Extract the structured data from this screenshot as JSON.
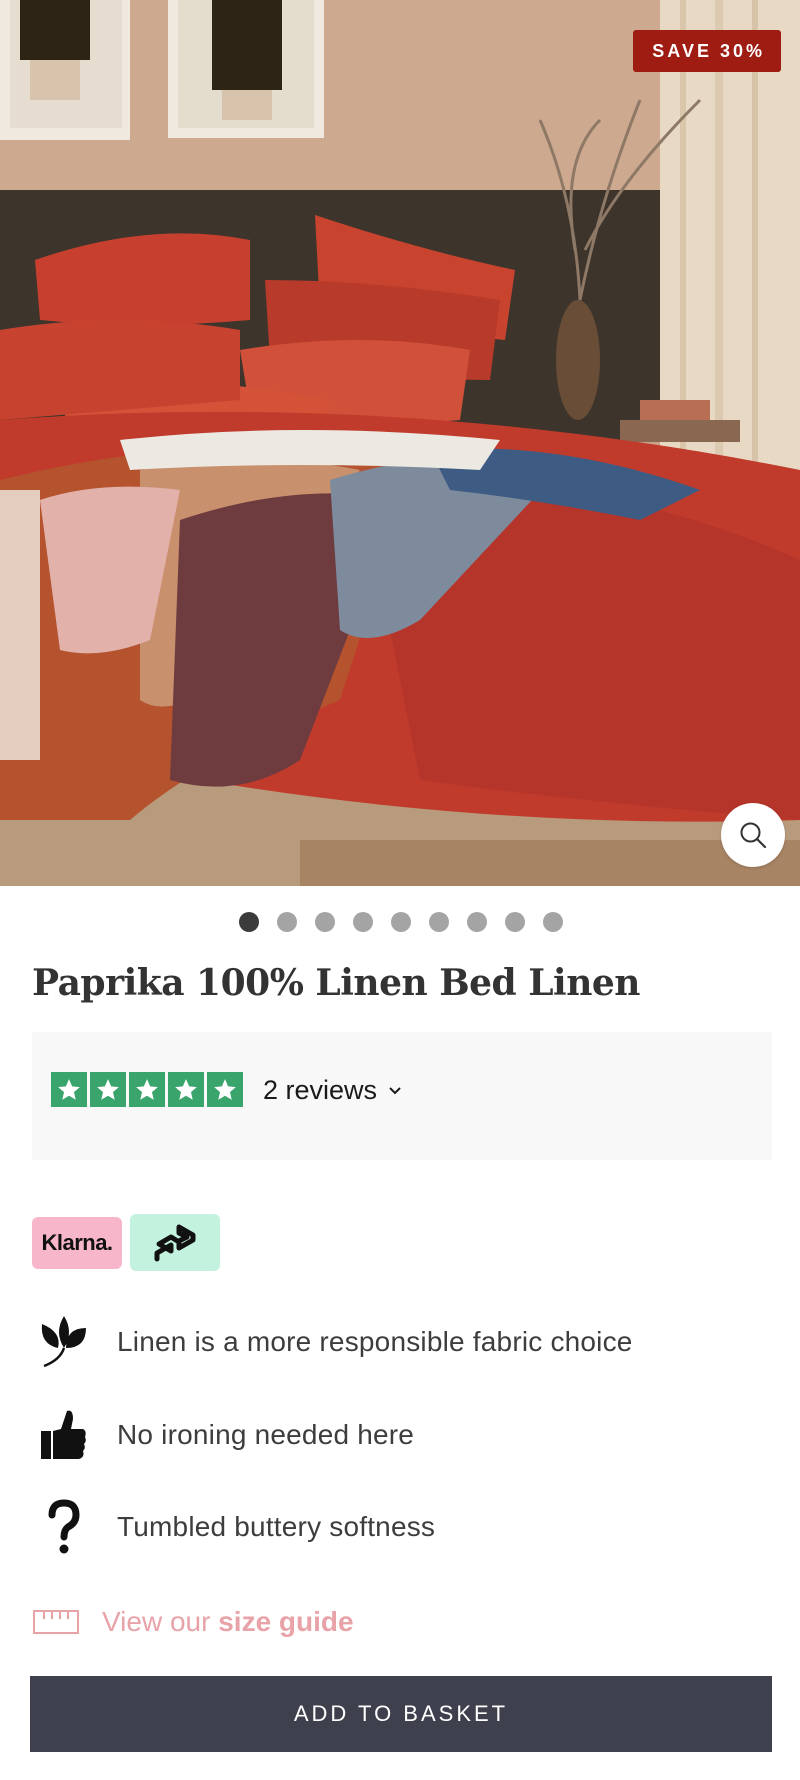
{
  "hero": {
    "badge": "SAVE 30%",
    "image_alt": "Paprika linen bedding on a bed with throws",
    "zoom_icon": "search-icon"
  },
  "gallery": {
    "dot_count": 9,
    "active_index": 0
  },
  "product": {
    "title": "Paprika 100% Linen Bed Linen"
  },
  "reviews": {
    "rating_stars": 5,
    "label": "2 reviews",
    "star_color": "#3aa46d"
  },
  "payments": {
    "klarna_label": "Klarna.",
    "afterpay_icon": "afterpay-logo"
  },
  "features": [
    {
      "icon": "leaf-icon",
      "text": "Linen is a more responsible fabric choice"
    },
    {
      "icon": "thumbs-up-icon",
      "text": "No ironing needed here"
    },
    {
      "icon": "question-icon",
      "text": "Tumbled buttery softness"
    }
  ],
  "size_guide": {
    "prefix": "View our",
    "link": "size guide",
    "icon": "ruler-icon",
    "color": "#e8a3a9"
  },
  "basket": {
    "label": "ADD TO BASKET",
    "color": "#3e404e"
  },
  "colors": {
    "badge": "#9e1c11",
    "linen": "#c4402c"
  }
}
